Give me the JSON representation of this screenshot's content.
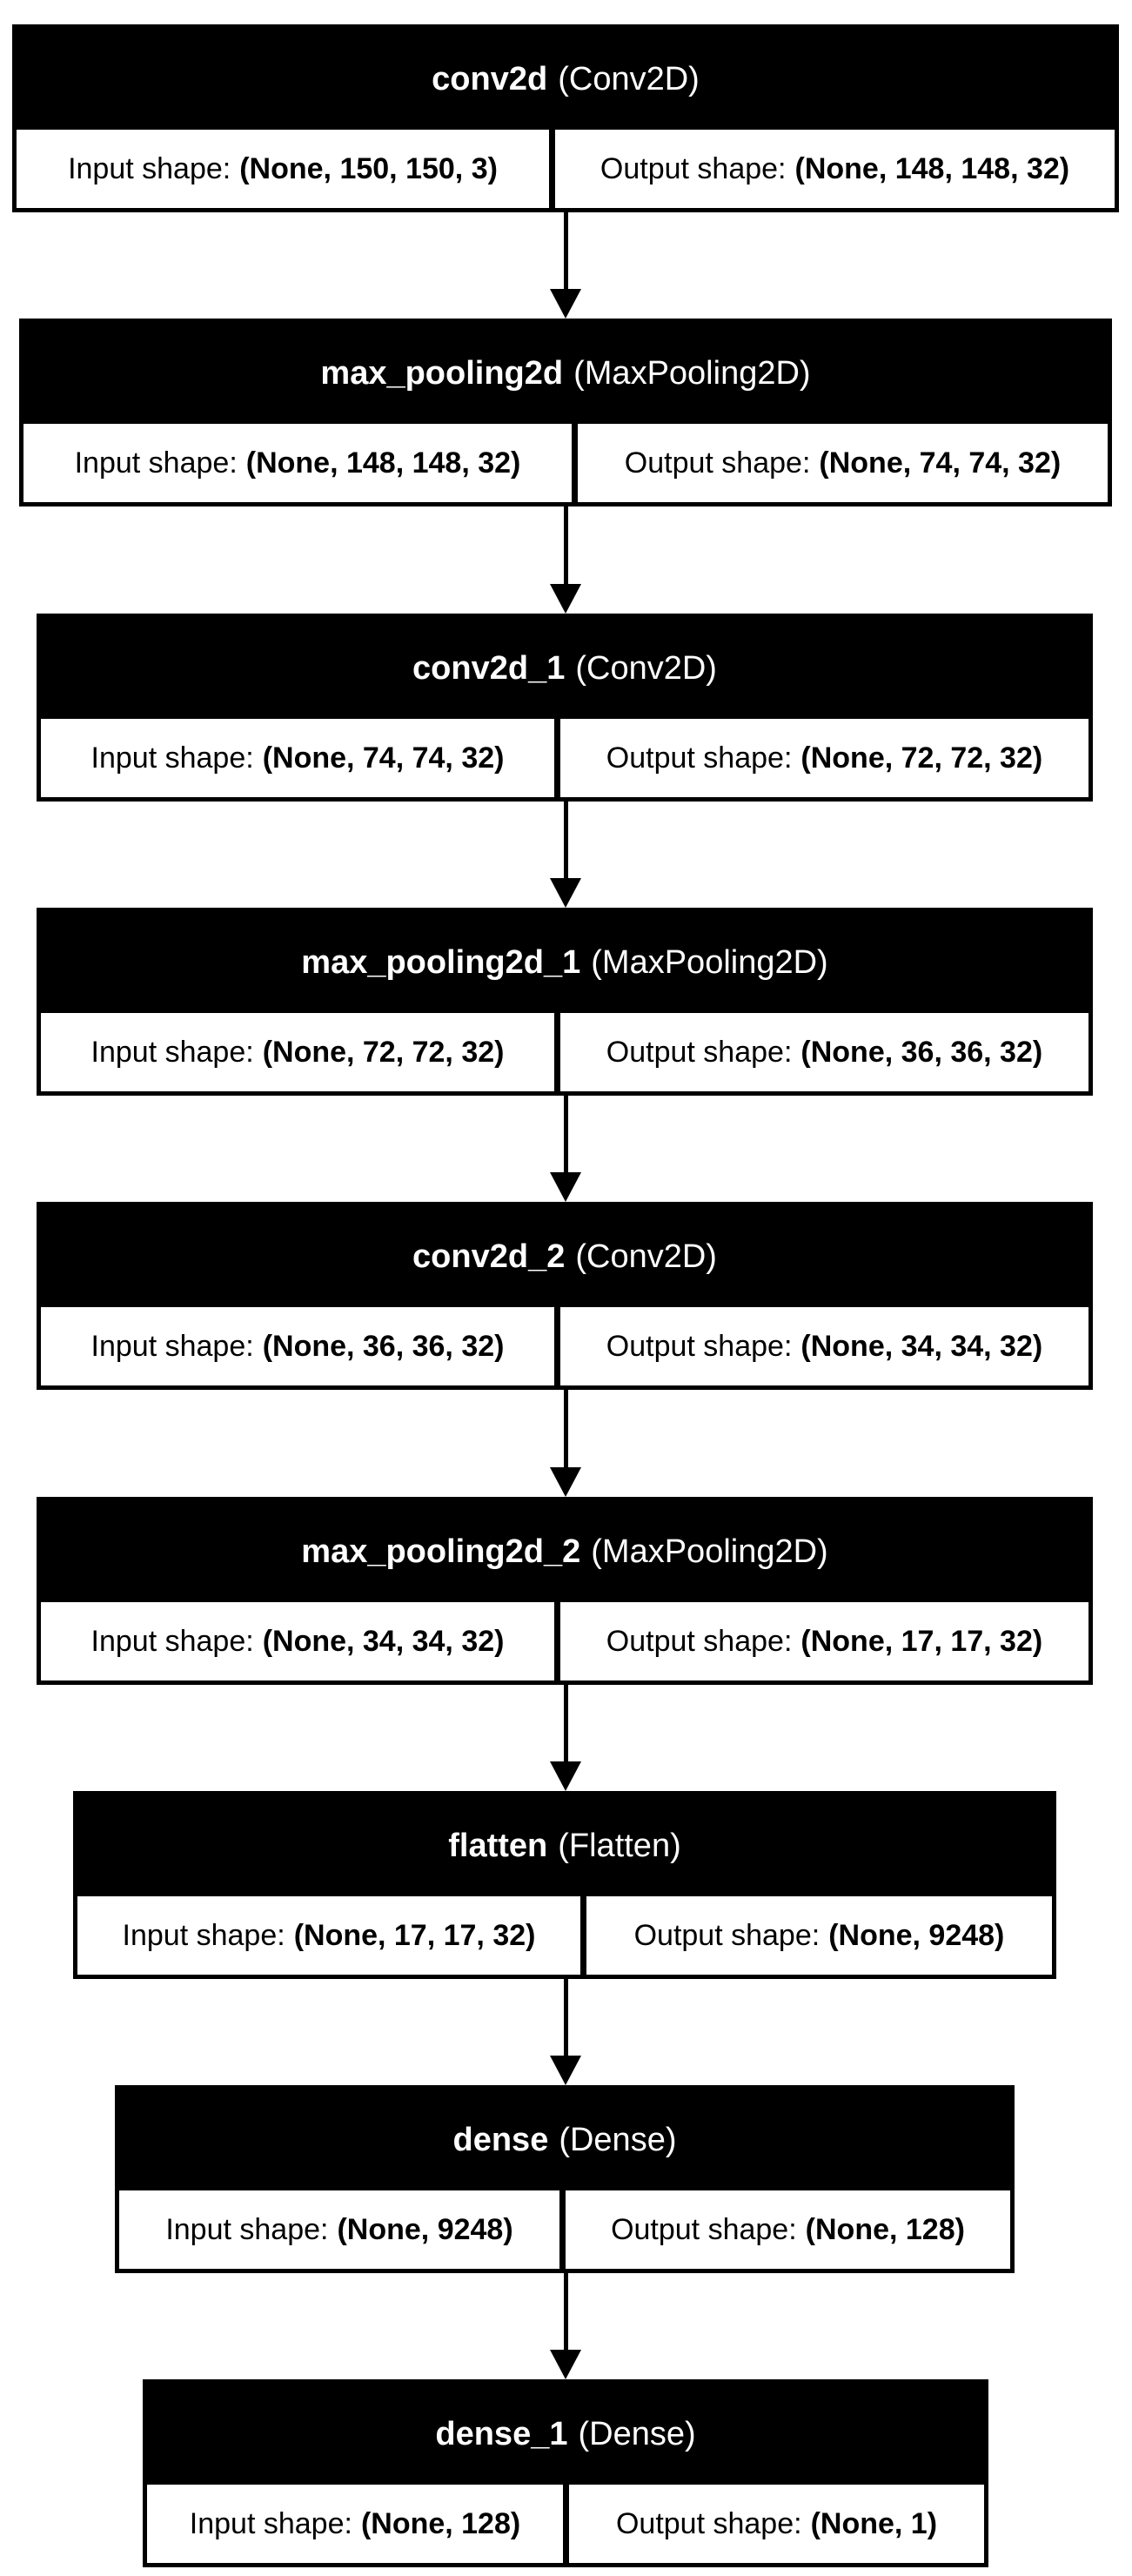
{
  "labels": {
    "input": "Input shape:",
    "output": "Output shape:"
  },
  "layers": [
    {
      "name": "conv2d",
      "type": "(Conv2D)",
      "input_shape": "(None, 150, 150, 3)",
      "output_shape": "(None, 148, 148, 32)"
    },
    {
      "name": "max_pooling2d",
      "type": "(MaxPooling2D)",
      "input_shape": "(None, 148, 148, 32)",
      "output_shape": "(None, 74, 74, 32)"
    },
    {
      "name": "conv2d_1",
      "type": "(Conv2D)",
      "input_shape": "(None, 74, 74, 32)",
      "output_shape": "(None, 72, 72, 32)"
    },
    {
      "name": "max_pooling2d_1",
      "type": "(MaxPooling2D)",
      "input_shape": "(None, 72, 72, 32)",
      "output_shape": "(None, 36, 36, 32)"
    },
    {
      "name": "conv2d_2",
      "type": "(Conv2D)",
      "input_shape": "(None, 36, 36, 32)",
      "output_shape": "(None, 34, 34, 32)"
    },
    {
      "name": "max_pooling2d_2",
      "type": "(MaxPooling2D)",
      "input_shape": "(None, 34, 34, 32)",
      "output_shape": "(None, 17, 17, 32)"
    },
    {
      "name": "flatten",
      "type": "(Flatten)",
      "input_shape": "(None, 17, 17, 32)",
      "output_shape": "(None, 9248)"
    },
    {
      "name": "dense",
      "type": "(Dense)",
      "input_shape": "(None, 9248)",
      "output_shape": "(None, 128)"
    },
    {
      "name": "dense_1",
      "type": "(Dense)",
      "input_shape": "(None, 128)",
      "output_shape": "(None, 1)"
    }
  ]
}
